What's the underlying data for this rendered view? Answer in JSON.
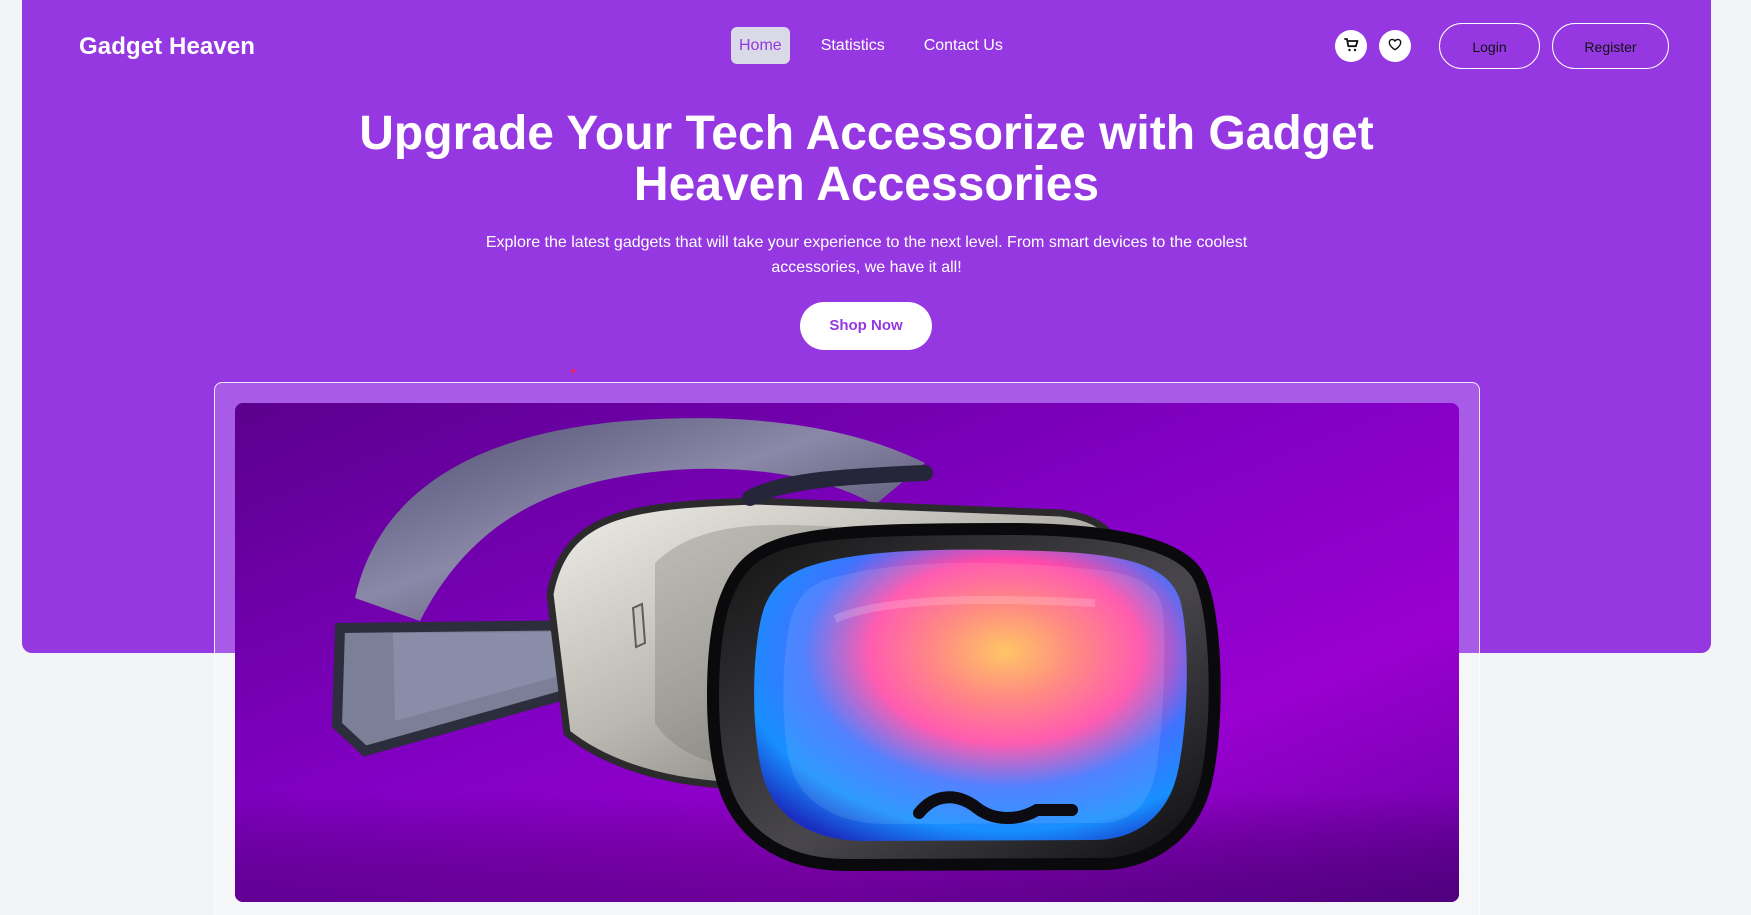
{
  "colors": {
    "brand": "#9538e2",
    "background": "#f3f4f6",
    "button_text": "#9538e2",
    "white": "#ffffff",
    "accent_dot": "#ff1f52"
  },
  "header": {
    "brand": "Gadget Heaven",
    "nav": [
      {
        "label": "Home",
        "active": true
      },
      {
        "label": "Statistics",
        "active": false
      },
      {
        "label": "Contact Us",
        "active": false
      }
    ],
    "actions": {
      "cart_icon": "shopping-cart-icon",
      "heart_icon": "heart-icon",
      "login_label": "Login",
      "register_label": "Register"
    }
  },
  "hero": {
    "title": "Upgrade Your Tech Accessorize with Gadget Heaven Accessories",
    "subtitle": "Explore the latest gadgets that will take your experience to the next level. From smart devices to the coolest accessories, we have it all!",
    "cta_label": "Shop Now"
  },
  "banner": {
    "icon": "vr-headset-image"
  }
}
